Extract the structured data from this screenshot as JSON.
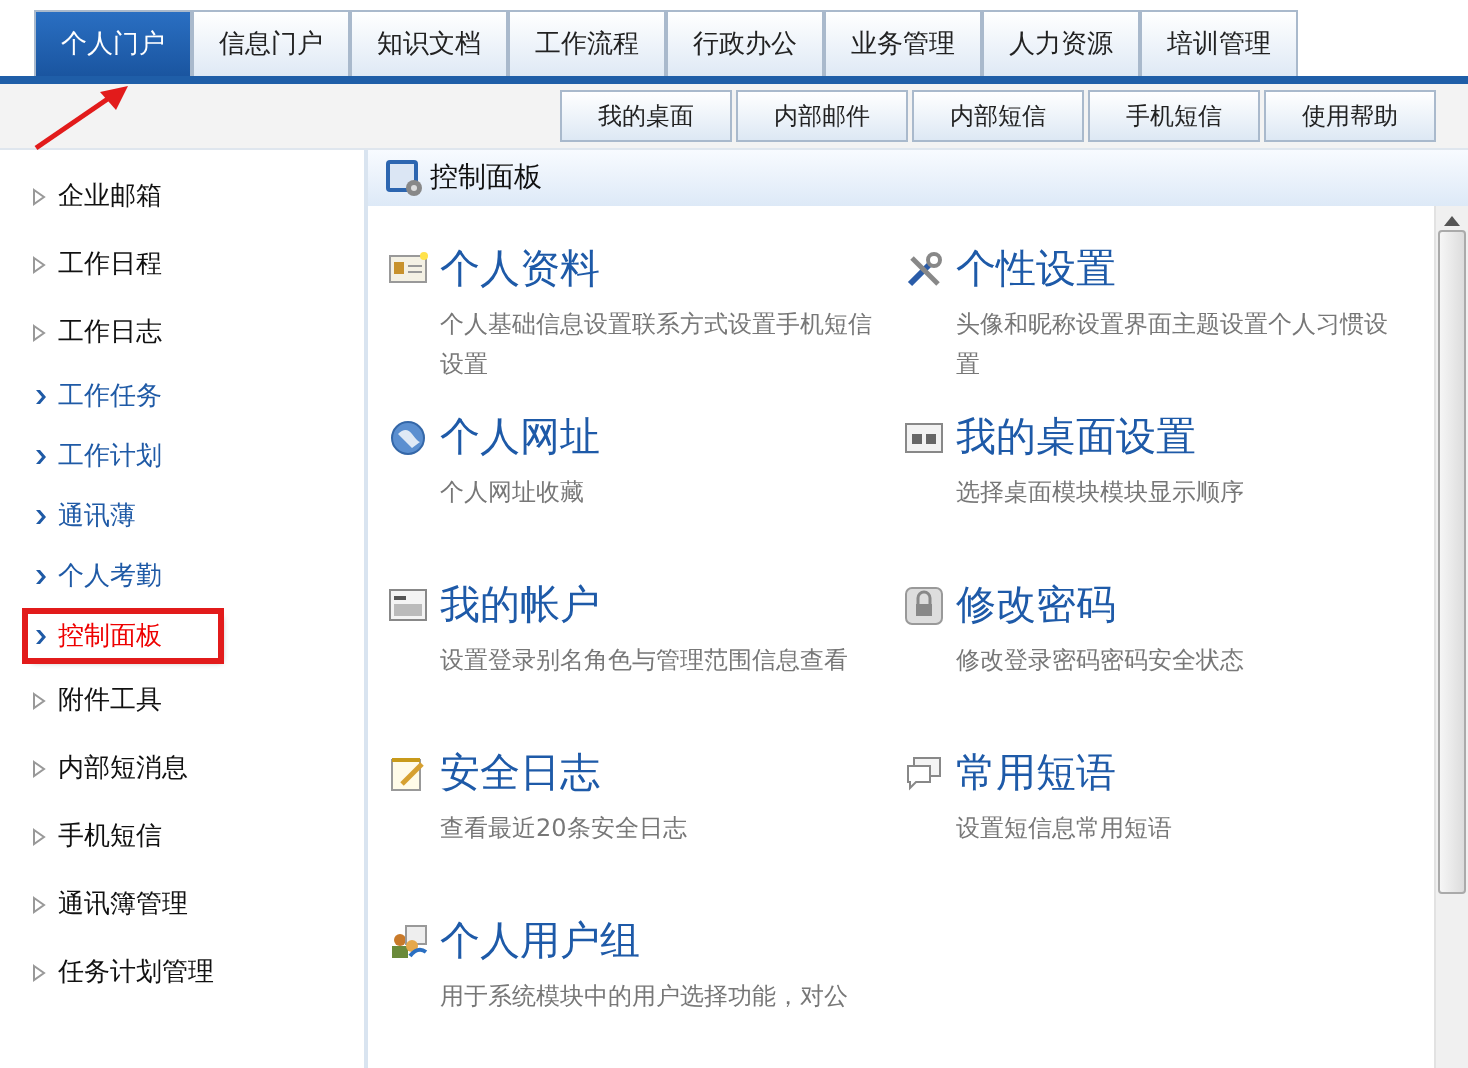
{
  "main_tabs": [
    {
      "label": "个人门户",
      "selected": true
    },
    {
      "label": "信息门户",
      "selected": false
    },
    {
      "label": "知识文档",
      "selected": false
    },
    {
      "label": "工作流程",
      "selected": false
    },
    {
      "label": "行政办公",
      "selected": false
    },
    {
      "label": "业务管理",
      "selected": false
    },
    {
      "label": "人力资源",
      "selected": false
    },
    {
      "label": "培训管理",
      "selected": false
    }
  ],
  "sub_buttons": [
    "我的桌面",
    "内部邮件",
    "内部短信",
    "手机短信",
    "使用帮助"
  ],
  "sidebar": {
    "items": [
      {
        "kind": "group",
        "label": "企业邮箱",
        "selected": false
      },
      {
        "kind": "group",
        "label": "工作日程",
        "selected": false
      },
      {
        "kind": "group",
        "label": "工作日志",
        "selected": false
      },
      {
        "kind": "link",
        "label": "工作任务",
        "selected": false
      },
      {
        "kind": "link",
        "label": "工作计划",
        "selected": false
      },
      {
        "kind": "link",
        "label": "通讯薄",
        "selected": false
      },
      {
        "kind": "link",
        "label": "个人考勤",
        "selected": false
      },
      {
        "kind": "link",
        "label": "控制面板",
        "selected": true
      },
      {
        "kind": "group",
        "label": "附件工具",
        "selected": false
      },
      {
        "kind": "group",
        "label": "内部短消息",
        "selected": false
      },
      {
        "kind": "group",
        "label": "手机短信",
        "selected": false
      },
      {
        "kind": "group",
        "label": "通讯簿管理",
        "selected": false
      },
      {
        "kind": "group",
        "label": "任务计划管理",
        "selected": false
      }
    ]
  },
  "panel": {
    "title": "控制面板",
    "items": [
      {
        "kind": "card",
        "title": "个人资料",
        "description": "个人基础信息设置联系方式设置手机短信设置"
      },
      {
        "kind": "tools",
        "title": "个性设置",
        "description": "头像和昵称设置界面主题设置个人习惯设置"
      },
      {
        "kind": "globe",
        "title": "个人网址",
        "description": "个人网址收藏"
      },
      {
        "kind": "desktop",
        "title": "我的桌面设置",
        "description": "选择桌面模块模块显示顺序"
      },
      {
        "kind": "account",
        "title": "我的帐户",
        "description": "设置登录别名角色与管理范围信息查看"
      },
      {
        "kind": "lock",
        "title": "修改密码",
        "description": "修改登录密码密码安全状态"
      },
      {
        "kind": "log",
        "title": "安全日志",
        "description": "查看最近20条安全日志"
      },
      {
        "kind": "chat",
        "title": "常用短语",
        "description": "设置短信息常用短语"
      },
      {
        "kind": "group",
        "title": "个人用户组",
        "description": "用于系统模块中的用户选择功能，对公"
      }
    ]
  }
}
